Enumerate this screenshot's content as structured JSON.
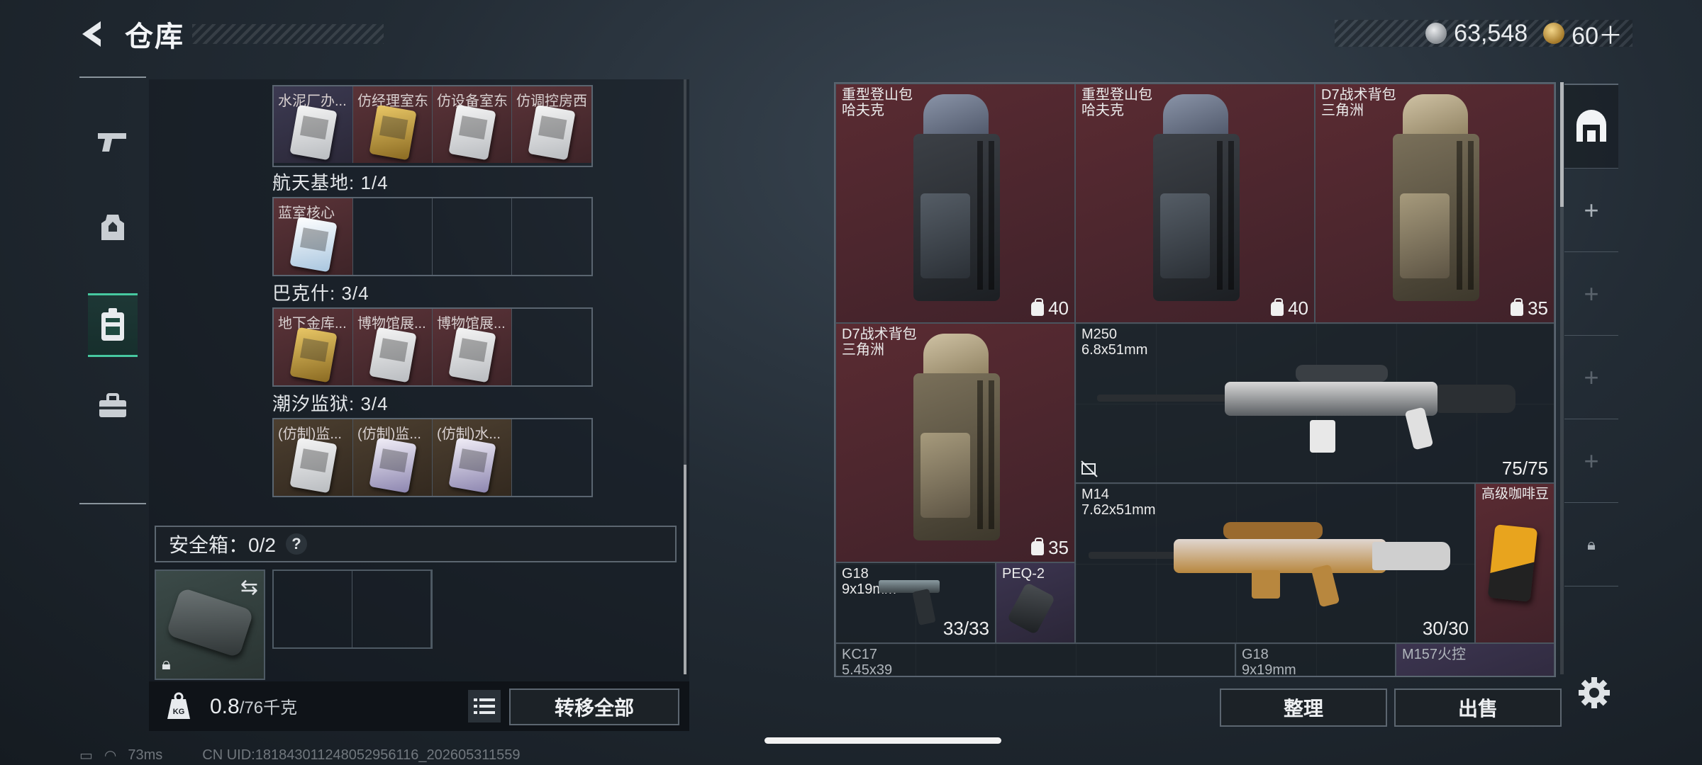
{
  "header": {
    "title": "仓库",
    "currency_silver": "63,548",
    "currency_gold": "60＋"
  },
  "left": {
    "top_row": [
      "水泥厂办...",
      "仿经理室东",
      "仿设备室东",
      "仿调控房西"
    ],
    "sections": [
      {
        "label": "航天基地: 1/4",
        "items": [
          "蓝室核心"
        ]
      },
      {
        "label": "巴克什: 3/4",
        "items": [
          "地下金库...",
          "博物馆展...",
          "博物馆展..."
        ]
      },
      {
        "label": "潮汐监狱: 3/4",
        "items": [
          "(仿制)监...",
          "(仿制)监...",
          "(仿制)水..."
        ]
      }
    ],
    "safebox_label": "安全箱：0/2",
    "help": "?",
    "weight_current": "0.8",
    "weight_max": "/76千克",
    "transfer_all": "转移全部"
  },
  "stash": {
    "items": [
      {
        "name": "重型登山包\n哈夫克",
        "count": "40"
      },
      {
        "name": "重型登山包\n哈夫克",
        "count": "40"
      },
      {
        "name": "D7战术背包\n三角洲",
        "count": "35"
      },
      {
        "name": "D7战术背包\n三角洲",
        "count": "35"
      },
      {
        "name": "M250\n6.8x51mm",
        "count": "75/75"
      },
      {
        "name": "M14\n7.62x51mm",
        "count": "30/30"
      },
      {
        "name": "高级咖啡豆",
        "count": ""
      },
      {
        "name": "G18\n9x19mm",
        "count": "33/33"
      },
      {
        "name": "PEQ-2",
        "count": ""
      },
      {
        "name": "KC17\n5.45x39",
        "count": ""
      },
      {
        "name": "G18\n9x19mm",
        "count": ""
      },
      {
        "name": "M157火控",
        "count": ""
      }
    ]
  },
  "buttons": {
    "organize": "整理",
    "sell": "出售"
  },
  "status": {
    "ping": "73ms",
    "uid": "CN UID:181843011248052956116_202605311559"
  },
  "colors": {
    "accent": "#47c8a0",
    "item_red": "#5a2b32",
    "coffee": "#e8a41e"
  }
}
